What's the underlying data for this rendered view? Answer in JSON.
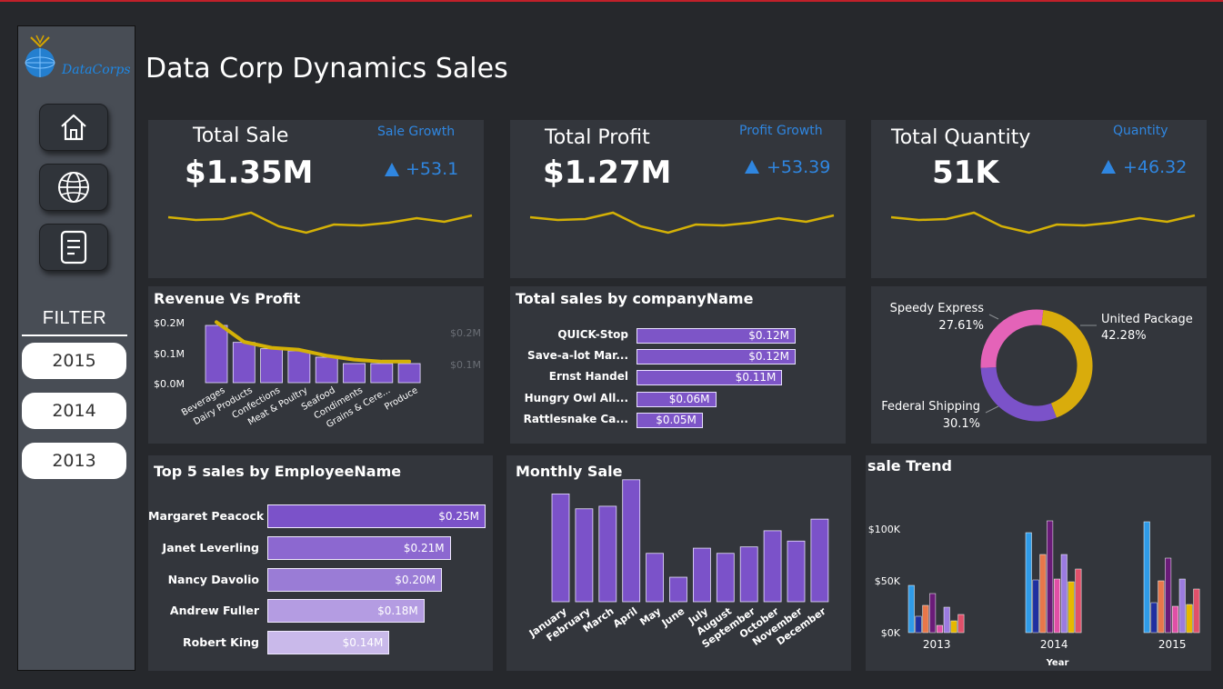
{
  "app": {
    "title": "Data Corp Dynamics Sales",
    "logo_text": "DataCorps"
  },
  "sidebar": {
    "nav": [
      {
        "icon": "home-icon"
      },
      {
        "icon": "globe-icon"
      },
      {
        "icon": "document-icon"
      }
    ],
    "filter_label": "FILTER",
    "years": [
      "2015",
      "2014",
      "2013"
    ]
  },
  "kpis": [
    {
      "title": "Total Sale",
      "value": "$1.35M",
      "growth_label": "Sale Growth",
      "growth_value": "+53.1",
      "trend": [
        55,
        52,
        53,
        60,
        45,
        38,
        47,
        46,
        49,
        54,
        50,
        57
      ]
    },
    {
      "title": "Total Profit",
      "value": "$1.27M",
      "growth_label": "Profit Growth",
      "growth_value": "+53.39",
      "trend": [
        55,
        52,
        53,
        60,
        45,
        38,
        47,
        46,
        49,
        54,
        50,
        57
      ]
    },
    {
      "title": "Total Quantity",
      "value": "51K",
      "growth_label": "Quantity",
      "growth_value": "+46.32",
      "trend": [
        55,
        52,
        53,
        60,
        45,
        38,
        47,
        46,
        49,
        54,
        50,
        57
      ]
    }
  ],
  "colors": {
    "bar_purple": "#7b52c9",
    "line_gold": "#d4b106",
    "accent_blue": "#2f86e0",
    "card_bg": "#33363c",
    "page_bg": "#26282c"
  },
  "chart_data": [
    {
      "type": "bar",
      "title": "Revenue Vs Profit",
      "categories": [
        "Beverages",
        "Dairy Products",
        "Confections",
        "Meat & Poultry",
        "Seafood",
        "Condiments",
        "Grains & Cere...",
        "Produce"
      ],
      "series": [
        {
          "name": "Revenue",
          "values": [
            0.27,
            0.19,
            0.16,
            0.15,
            0.12,
            0.09,
            0.09,
            0.09
          ]
        },
        {
          "name": "Profit",
          "values": [
            0.27,
            0.17,
            0.14,
            0.13,
            0.1,
            0.08,
            0.07,
            0.07
          ]
        }
      ],
      "yticks": [
        "$0.2M",
        "$0.1M",
        "$0.0M"
      ],
      "y2ticks": [
        "$0.2M",
        "$0.1M"
      ],
      "ylim": [
        0,
        0.3
      ]
    },
    {
      "type": "bar",
      "title": "Total sales by companyName",
      "categories": [
        "QUICK-Stop",
        "Save-a-lot Mar...",
        "Ernst Handel",
        "Hungry Owl All...",
        "Rattlesnake Ca..."
      ],
      "values": [
        0.12,
        0.12,
        0.11,
        0.06,
        0.05
      ],
      "labels": [
        "$0.12M",
        "$0.12M",
        "$0.11M",
        "$0.06M",
        "$0.05M"
      ]
    },
    {
      "type": "pie",
      "title": "",
      "slices": [
        {
          "name": "United Package",
          "label": "42.28%",
          "value": 42.28,
          "color": "#d9ac0c"
        },
        {
          "name": "Federal Shipping",
          "label": "30.1%",
          "value": 30.1,
          "color": "#7b52c9"
        },
        {
          "name": "Speedy Express",
          "label": "27.61%",
          "value": 27.61,
          "color": "#e463b8"
        }
      ]
    },
    {
      "type": "bar",
      "title": "Top 5 sales by EmployeeName",
      "categories": [
        "Margaret Peacock",
        "Janet Leverling",
        "Nancy Davolio",
        "Andrew Fuller",
        "Robert King"
      ],
      "values": [
        0.25,
        0.21,
        0.2,
        0.18,
        0.14
      ],
      "labels": [
        "$0.25M",
        "$0.21M",
        "$0.20M",
        "$0.18M",
        "$0.14M"
      ],
      "colors": [
        "#7b52c9",
        "#8c68d0",
        "#9a7cd6",
        "#b49ce2",
        "#c9b9ea"
      ]
    },
    {
      "type": "bar",
      "title": "Monthly Sale",
      "categories": [
        "January",
        "February",
        "March",
        "April",
        "May",
        "June",
        "July",
        "August",
        "September",
        "October",
        "November",
        "December"
      ],
      "values": [
        167,
        144,
        148,
        189,
        75,
        38,
        83,
        75,
        85,
        110,
        94,
        128
      ],
      "ylim": [
        0,
        200
      ]
    },
    {
      "type": "bar",
      "title": "sale Trend",
      "xlabel": "Year",
      "categories": [
        "2013",
        "2014",
        "2015"
      ],
      "yticks": [
        "$100K",
        "$50K",
        "$0K"
      ],
      "ylim": [
        0,
        130
      ],
      "series": [
        {
          "values": [
            52,
            110,
            122
          ],
          "color": "#2f9be8"
        },
        {
          "values": [
            18,
            58,
            33
          ],
          "color": "#1f2fa0"
        },
        {
          "values": [
            30,
            86,
            57
          ],
          "color": "#e8774a"
        },
        {
          "values": [
            43,
            123,
            82
          ],
          "color": "#6a1b78"
        },
        {
          "values": [
            8,
            59,
            29
          ],
          "color": "#e04fa6"
        },
        {
          "values": [
            28,
            86,
            59
          ],
          "color": "#9b7be0"
        },
        {
          "values": [
            13,
            56,
            31
          ],
          "color": "#e6b800"
        },
        {
          "values": [
            20,
            70,
            48
          ],
          "color": "#e0506a"
        }
      ]
    }
  ]
}
